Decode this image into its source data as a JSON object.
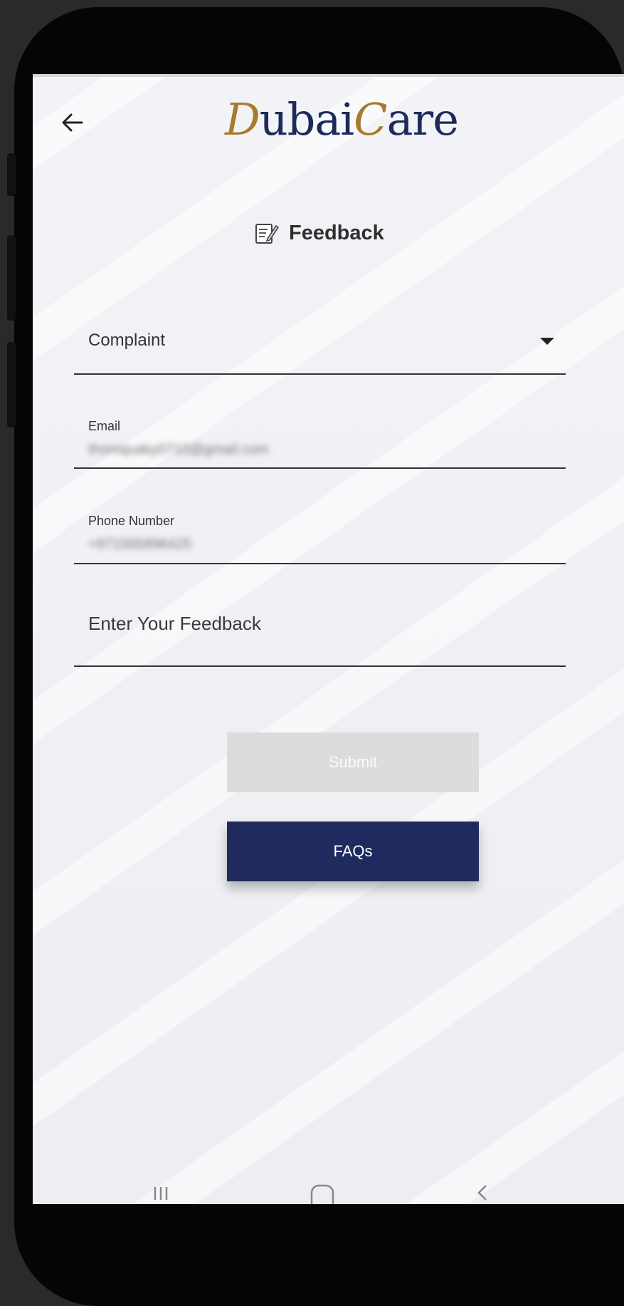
{
  "app": {
    "logo_text_part1": "D",
    "logo_text_part2": "ubai",
    "logo_text_part3": "C",
    "logo_text_part4": "are"
  },
  "header": {
    "title": "Feedback"
  },
  "form": {
    "type_value": "Complaint",
    "email_label": "Email",
    "email_value": "thomquaky0710@gmail.com",
    "phone_label": "Phone Number",
    "phone_value": "+971565896425",
    "feedback_placeholder": "Enter Your Feedback"
  },
  "buttons": {
    "submit_label": "Submit",
    "faqs_label": "FAQs"
  },
  "icons": {
    "back": "arrow-left-icon",
    "feedback": "document-edit-icon",
    "dropdown": "caret-down-icon"
  },
  "colors": {
    "brand_navy": "#1f2b5e",
    "brand_gold": "#a97a2c",
    "disabled_button": "#dcdcdc"
  }
}
